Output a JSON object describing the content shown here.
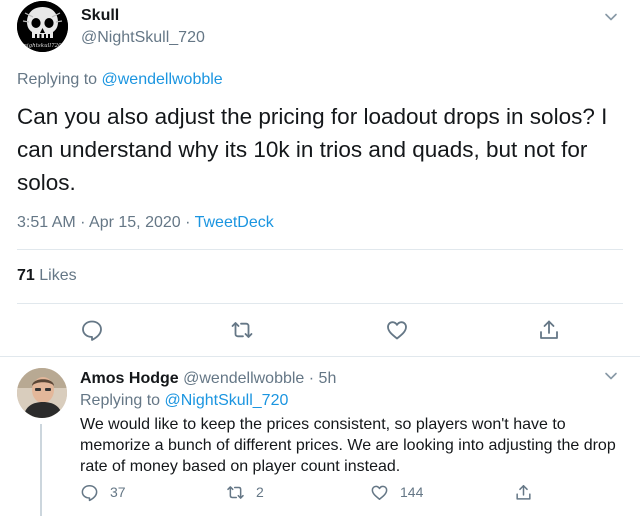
{
  "main_tweet": {
    "display_name": "Skull",
    "handle": "@NightSkull_720",
    "avatar_caption": "nightskull720",
    "replying_prefix": "Replying to ",
    "replying_to": "@wendellwobble",
    "text": "Can you also adjust the pricing for loadout drops in solos? I can understand why its 10k in trios and quads, but not for solos.",
    "timestamp": "3:51 AM · Apr 15, 2020 · ",
    "source": "TweetDeck",
    "like_count": "71",
    "likes_label": " Likes",
    "icons": [
      "reply-icon",
      "retweet-icon",
      "like-icon",
      "share-icon",
      "chevron-down-icon"
    ]
  },
  "reply_tweet": {
    "display_name": "Amos Hodge",
    "handle": "@wendellwobble",
    "separator": " · ",
    "age": "5h",
    "replying_prefix": "Replying to ",
    "replying_to": "@NightSkull_720",
    "text": "We would like to keep the prices consistent, so players won't have to memorize a bunch of different prices. We are looking into adjusting the drop rate of money based on player count instead.",
    "reply_count": "37",
    "retweet_count": "2",
    "like_count": "144"
  },
  "colors": {
    "link": "#1b95e0",
    "secondary_text": "#657786",
    "divider": "#e1e8ed",
    "thread_line": "#ccd6dd"
  }
}
